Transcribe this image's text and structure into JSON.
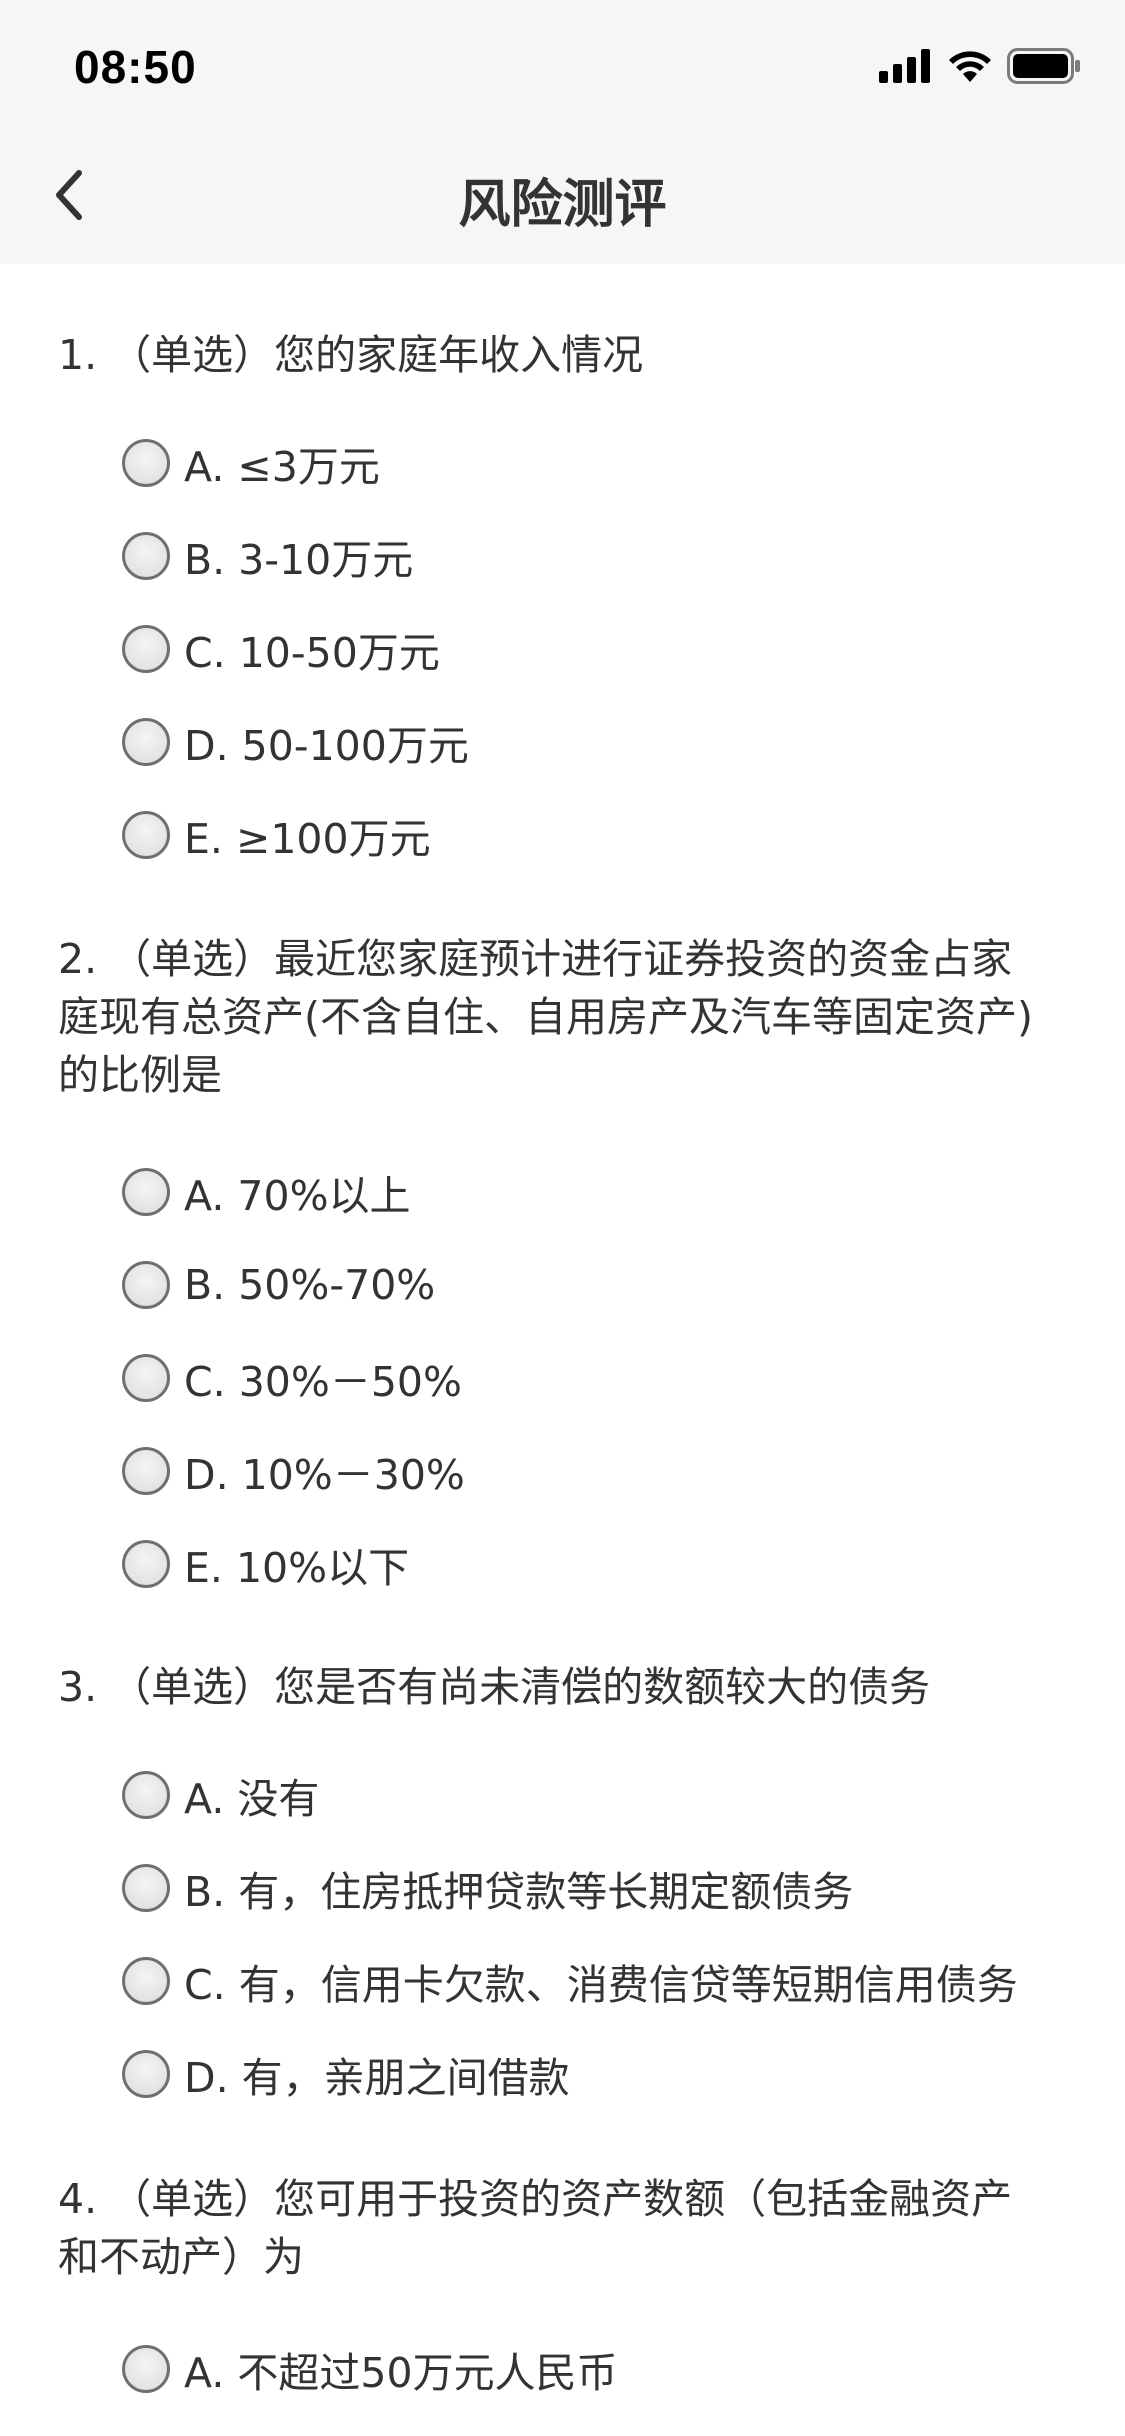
{
  "status_bar": {
    "time": "08:50",
    "icons": [
      "signal-icon",
      "wifi-icon",
      "battery-icon"
    ]
  },
  "nav": {
    "back_icon": "chevron-left-icon",
    "title": "风险测评"
  },
  "questions": [
    {
      "text": "1. （单选）您的家庭年收入情况",
      "options": [
        "A. ≤3万元",
        "B. 3-10万元",
        "C. 10-50万元",
        "D. 50-100万元",
        "E. ≥100万元"
      ]
    },
    {
      "text_lines": [
        "2. （单选）最近您家庭预计进行证券投资的资金占家",
        "庭现有总资产(不含自住、自用房产及汽车等固定资产)",
        "的比例是"
      ],
      "options": [
        "A. 70%以上",
        "B. 50%-70%",
        "C. 30%－50%",
        "D. 10%－30%",
        "E. 10%以下"
      ]
    },
    {
      "text": "3. （单选）您是否有尚未清偿的数额较大的债务",
      "options": [
        "A. 没有",
        "B. 有，住房抵押贷款等长期定额债务",
        "C. 有，信用卡欠款、消费信贷等短期信用债务",
        "D. 有，亲朋之间借款"
      ]
    },
    {
      "text_lines": [
        "4. （单选）您可用于投资的资产数额（包括金融资产",
        "和不动产）为"
      ],
      "options": [
        "A. 不超过50万元人民币"
      ]
    }
  ]
}
